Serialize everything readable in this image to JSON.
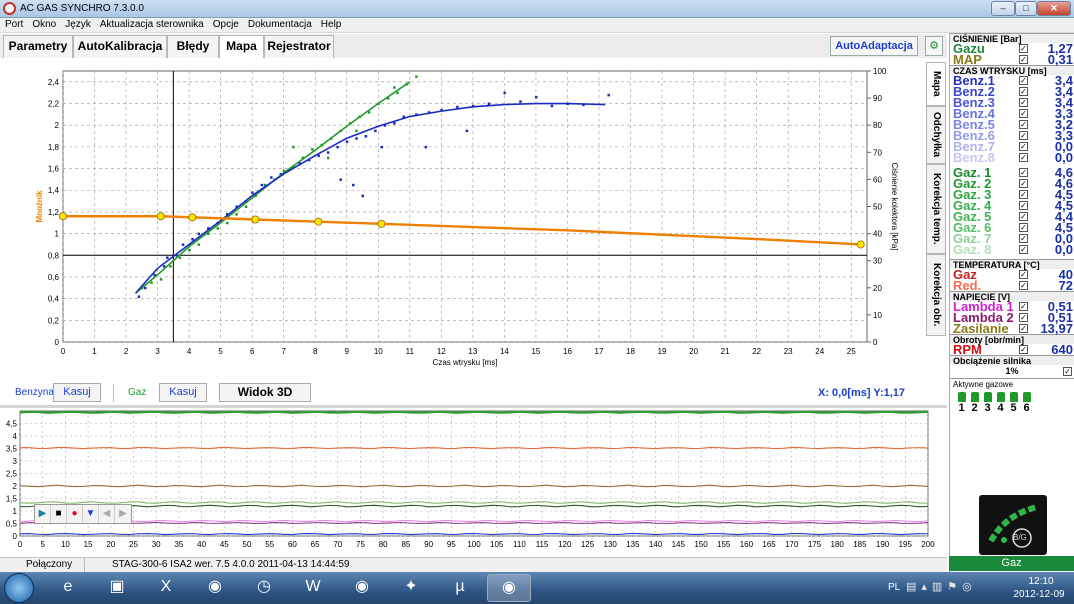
{
  "window": {
    "title": "AC GAS SYNCHRO  7.3.0.0"
  },
  "menu": [
    "Port",
    "Okno",
    "Język",
    "Aktualizacja sterownika",
    "Opcje",
    "Dokumentacja",
    "Help"
  ],
  "tabs": [
    "Parametry",
    "AutoKalibracja",
    "Błędy",
    "Mapa",
    "Rejestrator"
  ],
  "active_tab": "Mapa",
  "autoadaptacja": "AutoAdaptacja",
  "vtabs": [
    "Mapa",
    "Odchyłka",
    "Korekcja temp.",
    "Korekcja obr."
  ],
  "controls": {
    "benzyna_label": "Benzyna",
    "benzyna_kasuj": "Kasuj",
    "gaz_label": "Gaz",
    "gaz_kasuj": "Kasuj",
    "widok3d": "Widok 3D",
    "coords": "X:  0,0[ms] Y:1,17"
  },
  "colors": {
    "orange": "#ee8000",
    "blue": "#1a2bc5",
    "green": "#1f9a2a",
    "brand_green": "#198a3a"
  },
  "chart_data": [
    {
      "type": "scatter",
      "xlabel": "Czas wtrysku [ms]",
      "ylabel": "Mnożnik",
      "y2label": "Ciśnienie kolektora [kPa]",
      "xlim": [
        0,
        25.5
      ],
      "ylim": [
        0,
        2.5
      ],
      "y2lim": [
        0,
        100
      ],
      "xticks": [
        "0",
        "1",
        "2",
        "3",
        "4",
        "5",
        "6",
        "7",
        "8",
        "9",
        "10",
        "11",
        "12",
        "13",
        "14",
        "15",
        "16",
        "17",
        "18",
        "19",
        "20",
        "21",
        "22",
        "23",
        "24",
        "25"
      ],
      "yticks": [
        "0",
        "0,2",
        "0,4",
        "0,6",
        "0,8",
        "1",
        "1,2",
        "1,4",
        "1,6",
        "1,8",
        "2",
        "2,2",
        "2,4"
      ],
      "y2ticks": [
        "0",
        "10",
        "20",
        "30",
        "40",
        "50",
        "60",
        "70",
        "80",
        "90",
        "100"
      ],
      "multiplier_curve": {
        "name": "",
        "x": [
          0,
          3.1,
          4.1,
          6.1,
          8.1,
          10.1,
          13,
          16,
          19,
          22,
          25.3
        ],
        "y": [
          1.16,
          1.16,
          1.15,
          1.13,
          1.11,
          1.09,
          1.06,
          1.03,
          0.99,
          0.95,
          0.9
        ],
        "points_x": [
          0,
          3.1,
          4.1,
          6.1,
          8.1,
          10.1,
          25.3
        ]
      },
      "benzyna_trend": {
        "x": [
          2.3,
          3,
          4,
          5,
          6,
          7,
          8,
          9,
          10,
          11,
          12,
          13,
          14,
          15,
          16,
          17.2
        ],
        "y": [
          0.45,
          0.68,
          0.9,
          1.12,
          1.35,
          1.55,
          1.72,
          1.88,
          1.99,
          2.08,
          2.13,
          2.17,
          2.19,
          2.2,
          2.2,
          2.19
        ]
      },
      "gaz_trend": {
        "x": [
          2.3,
          3,
          4,
          5,
          6,
          7,
          8,
          9,
          10,
          11
        ],
        "y": [
          0.45,
          0.62,
          0.88,
          1.1,
          1.33,
          1.56,
          1.77,
          1.99,
          2.2,
          2.4
        ]
      },
      "benzyna_points": {
        "x": [
          2.4,
          2.6,
          2.9,
          3.2,
          3.3,
          3.6,
          3.8,
          4.1,
          4.3,
          4.6,
          4.9,
          5.2,
          5.5,
          5.8,
          6,
          6.3,
          6.6,
          6.9,
          7.2,
          7.5,
          7.8,
          8.1,
          8.4,
          8.7,
          9,
          9.3,
          9.6,
          9.9,
          10.2,
          10.5,
          10.8,
          11.2,
          11.6,
          12,
          12.5,
          13,
          13.5,
          14,
          14.5,
          15,
          15.5,
          16,
          16.5,
          17.3,
          9.2,
          9.5,
          8.8,
          10.1,
          11.5,
          12.8
        ],
        "y": [
          0.42,
          0.5,
          0.62,
          0.7,
          0.78,
          0.8,
          0.9,
          0.95,
          1.0,
          1.05,
          1.1,
          1.18,
          1.25,
          1.3,
          1.38,
          1.45,
          1.52,
          1.55,
          1.6,
          1.65,
          1.68,
          1.72,
          1.75,
          1.8,
          1.85,
          1.88,
          1.9,
          1.95,
          2.0,
          2.02,
          2.08,
          2.1,
          2.12,
          2.14,
          2.17,
          2.18,
          2.2,
          2.3,
          2.22,
          2.26,
          2.18,
          2.2,
          2.19,
          2.28,
          1.45,
          1.35,
          1.5,
          1.8,
          1.8,
          1.95
        ]
      },
      "gaz_points": {
        "x": [
          2.5,
          2.8,
          3.1,
          3.4,
          3.7,
          4,
          4.3,
          4.6,
          4.9,
          5.2,
          5.5,
          5.8,
          6.1,
          6.4,
          6.7,
          7,
          7.3,
          7.6,
          7.9,
          8.2,
          8.5,
          8.8,
          9.1,
          9.4,
          9.7,
          10,
          10.3,
          10.6,
          10.9,
          11.2,
          7.3,
          8.4,
          9.3,
          10.5
        ],
        "y": [
          0.5,
          0.55,
          0.58,
          0.7,
          0.78,
          0.85,
          0.9,
          1.0,
          1.05,
          1.1,
          1.18,
          1.25,
          1.35,
          1.45,
          1.5,
          1.58,
          1.62,
          1.7,
          1.78,
          1.82,
          1.88,
          1.95,
          2.02,
          2.08,
          2.12,
          2.2,
          2.25,
          2.3,
          2.38,
          2.45,
          1.8,
          1.7,
          1.95,
          2.35
        ]
      },
      "cursor_x": 3.5,
      "hline_y": 0.8,
      "grid": true
    },
    {
      "type": "line",
      "xlim": [
        0,
        200
      ],
      "ylim": [
        0,
        5
      ],
      "xticks": [
        "0",
        "5",
        "10",
        "15",
        "20",
        "25",
        "30",
        "35",
        "40",
        "45",
        "50",
        "55",
        "60",
        "65",
        "70",
        "75",
        "80",
        "85",
        "90",
        "95",
        "100",
        "105",
        "110",
        "115",
        "120",
        "125",
        "130",
        "135",
        "140",
        "145",
        "150",
        "155",
        "160",
        "165",
        "170",
        "175",
        "180",
        "185",
        "190",
        "195",
        "200"
      ],
      "yticks": [
        "0",
        "0,5",
        "1",
        "1,5",
        "2",
        "2,5",
        "3",
        "3,5",
        "4",
        "4,5"
      ],
      "series": [
        {
          "color": "#2fa02f",
          "level": 4.95
        },
        {
          "color": "#e86a3a",
          "level": 3.52
        },
        {
          "color": "#9c6a3a",
          "level": 2.0
        },
        {
          "color": "#7fb86a",
          "level": 1.34
        },
        {
          "color": "#2c5a2c",
          "level": 1.2
        },
        {
          "color": "#ee88ee",
          "level": 0.6
        },
        {
          "color": "#8a4a8a",
          "level": 0.52
        },
        {
          "color": "#1e3bd8",
          "level": 0.08
        }
      ],
      "grid": true
    }
  ],
  "status": {
    "conn": "Połączony",
    "info": "STAG-300-6 ISA2  wer. 7.5  4.0.0   2011-04-13 14:44:59"
  },
  "right": {
    "cisnienie_head": "CIŚNIENIE [Bar]",
    "cisnienie": [
      {
        "label": "Gazu",
        "value": "1,27",
        "color": "#198a3a"
      },
      {
        "label": "MAP",
        "value": "0,31",
        "color": "#8a7a1a"
      }
    ],
    "czas_head": "CZAS WTRYSKU [ms]",
    "benz": [
      {
        "label": "Benz.1",
        "value": "3,4",
        "color": "#2530c0"
      },
      {
        "label": "Benz.2",
        "value": "3,4",
        "color": "#3a45d0"
      },
      {
        "label": "Benz.3",
        "value": "3,4",
        "color": "#4a55dd"
      },
      {
        "label": "Benz.4",
        "value": "3,3",
        "color": "#6570e0"
      },
      {
        "label": "Benz.5",
        "value": "3,2",
        "color": "#7c85e6"
      },
      {
        "label": "Benz.6",
        "value": "3,3",
        "color": "#939ae9"
      },
      {
        "label": "Benz.7",
        "value": "0,0",
        "color": "#aeb2ee"
      },
      {
        "label": "Benz.8",
        "value": "0,0",
        "color": "#c4c6f2"
      }
    ],
    "gaz": [
      {
        "label": "Gaz. 1",
        "value": "4,6",
        "color": "#1a8a2a"
      },
      {
        "label": "Gaz. 2",
        "value": "4,6",
        "color": "#239a35"
      },
      {
        "label": "Gaz. 3",
        "value": "4,5",
        "color": "#2ca540"
      },
      {
        "label": "Gaz. 4",
        "value": "4,5",
        "color": "#36ae4c"
      },
      {
        "label": "Gaz. 5",
        "value": "4,4",
        "color": "#40b456"
      },
      {
        "label": "Gaz. 6",
        "value": "4,5",
        "color": "#52bc66"
      },
      {
        "label": "Gaz. 7",
        "value": "0,0",
        "color": "#8fd09a"
      },
      {
        "label": "Gaz. 8",
        "value": "0,0",
        "color": "#b3ddb9"
      }
    ],
    "temp_head": "TEMPERATURA [°C]",
    "temp": [
      {
        "label": "Gaz",
        "value": "40",
        "color": "#c02020"
      },
      {
        "label": "Red.",
        "value": "72",
        "color": "#ee7050"
      }
    ],
    "nap_head": "NAPIĘCIE [V]",
    "nap": [
      {
        "label": "Lambda 1",
        "value": "0,51",
        "color": "#d020d0"
      },
      {
        "label": "Lambda 2",
        "value": "0,51",
        "color": "#8a1a6a"
      },
      {
        "label": "Zasilanie",
        "value": "13,97",
        "color": "#8a7a1a"
      }
    ],
    "obroty_head": "Obroty [obr/min]",
    "rpm": {
      "label": "RPM",
      "value": "640",
      "color": "#d01010"
    },
    "obc_head": "Obciążenie silnika",
    "obc_value": "1%",
    "aktywne_head": "Aktywne gazowe",
    "injectors": [
      "1",
      "2",
      "3",
      "4",
      "5",
      "6"
    ],
    "bg_label": "B/G",
    "gaz_btn": "Gaz"
  },
  "taskbar": {
    "lang": "PL",
    "time": "12:10",
    "date": "2012-12-09",
    "apps": [
      "ie-icon",
      "explorer-icon",
      "excel-icon",
      "app-icon",
      "clock-icon",
      "word-icon",
      "firefox-icon",
      "pin-icon",
      "utorrent-icon",
      "acgas-icon"
    ]
  }
}
